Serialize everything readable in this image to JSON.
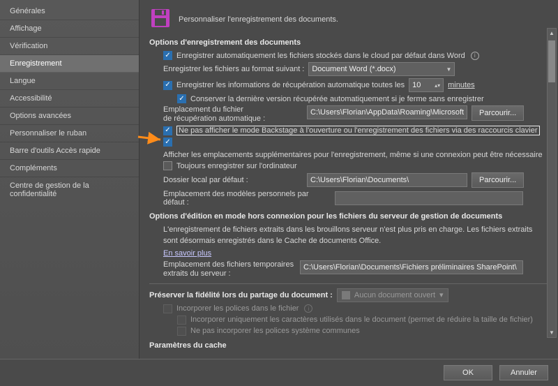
{
  "header": {
    "title": "Personnaliser l'enregistrement des documents."
  },
  "sidebar": {
    "items": [
      "Générales",
      "Affichage",
      "Vérification",
      "Enregistrement",
      "Langue",
      "Accessibilité",
      "Options avancées",
      "Personnaliser le ruban",
      "Barre d'outils Accès rapide",
      "Compléments",
      "Centre de gestion de la confidentialité"
    ],
    "selected_index": 3
  },
  "sections": {
    "save_options_title": "Options d'enregistrement des documents",
    "autosave_cloud": "Enregistrer automatiquement les fichiers stockés dans le cloud par défaut dans Word",
    "save_format_label": "Enregistrer les fichiers au format suivant :",
    "save_format_value": "Document Word (*.docx)",
    "autorecover_label": "Enregistrer les informations de récupération automatique toutes les",
    "autorecover_value": "10",
    "autorecover_unit": "minutes",
    "keep_last_version": "Conserver la dernière version récupérée automatiquement si je ferme sans enregistrer",
    "autorecover_loc_label1": "Emplacement du fichier",
    "autorecover_loc_label2": "de récupération automatique :",
    "autorecover_loc_value": "C:\\Users\\Florian\\AppData\\Roaming\\Microsoft\\Wo",
    "browse": "Parcourir...",
    "no_backstage": "Ne pas afficher le mode Backstage à l'ouverture ou l'enregistrement des fichiers via des raccourcis clavier",
    "show_additional": "Afficher les emplacements supplémentaires pour l'enregistrement, même si une connexion peut être nécessaire",
    "always_local": "Toujours enregistrer sur l'ordinateur",
    "local_folder_label": "Dossier local par défaut :",
    "local_folder_value": "C:\\Users\\Florian\\Documents\\",
    "templates_label": "Emplacement des modèles personnels par défaut :",
    "templates_value": "",
    "offline_title": "Options d'édition en mode hors connexion pour les fichiers du serveur de gestion de documents",
    "offline_note1": "L'enregistrement de fichiers extraits dans les brouillons serveur n'est plus pris en charge. Les fichiers extraits sont désormais enregistrés dans le Cache de documents Office.",
    "offline_link": "En savoir plus",
    "temp_loc_label1": "Emplacement des fichiers temporaires",
    "temp_loc_label2": "extraits du serveur :",
    "temp_loc_value": "C:\\Users\\Florian\\Documents\\Fichiers préliminaires SharePoint\\",
    "fidelity_title": "Préserver la fidélité lors du partage du document :",
    "fidelity_doc": "Aucun document ouvert",
    "embed_fonts": "Incorporer les polices dans le fichier",
    "embed_chars": "Incorporer uniquement les caractères utilisés dans le document (permet de réduire la taille de fichier)",
    "embed_sys": "Ne pas incorporer les polices système communes",
    "cache_title": "Paramètres du cache"
  },
  "footer": {
    "ok": "OK",
    "cancel": "Annuler"
  }
}
